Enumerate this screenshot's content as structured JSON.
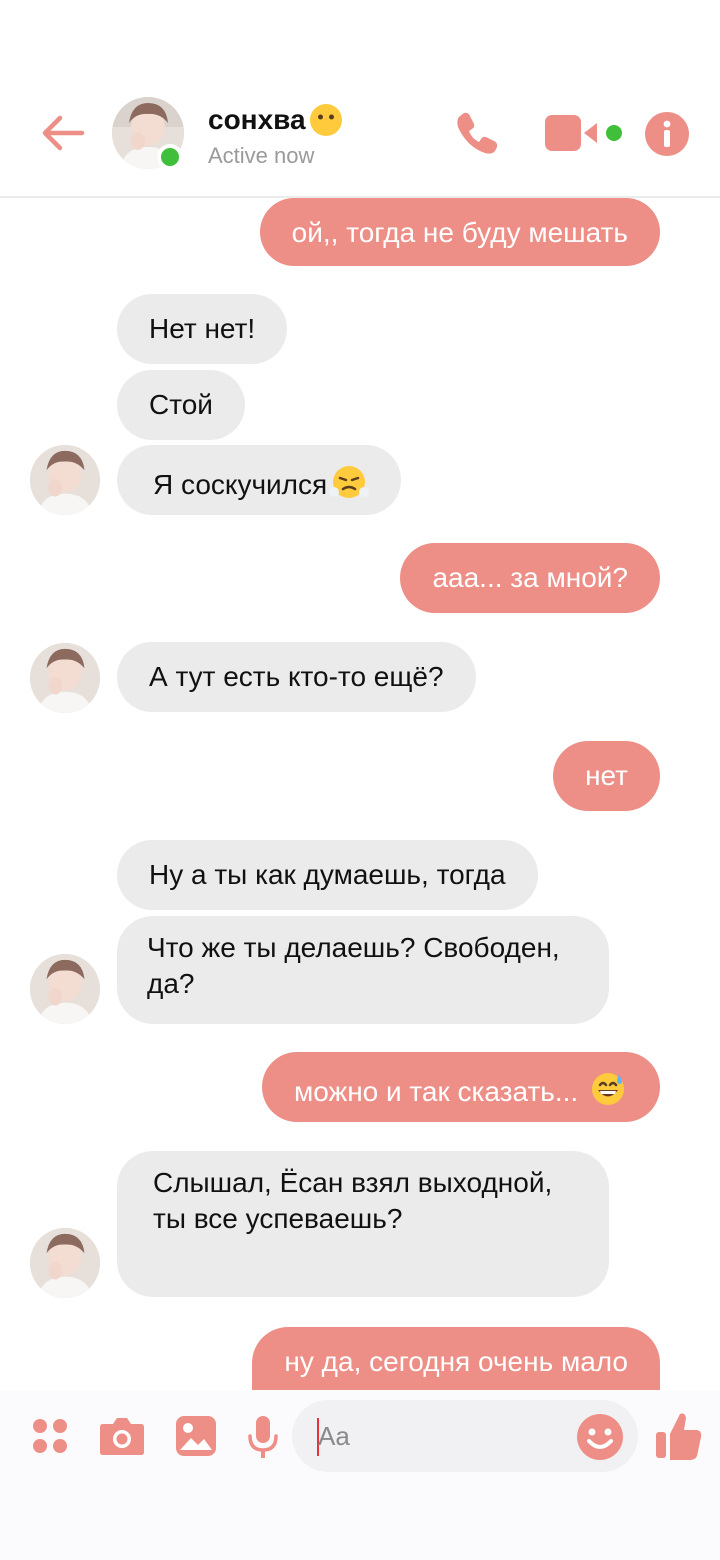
{
  "header": {
    "contact_name": "сонхва",
    "status": "Active now",
    "icons": {
      "back": "back-arrow-icon",
      "call": "phone-icon",
      "video": "video-camera-icon",
      "info": "info-icon"
    }
  },
  "messages": [
    {
      "from": "me",
      "text": "ой,, тогда не буду мешать"
    },
    {
      "from": "contact",
      "text": "Нет нет!"
    },
    {
      "from": "contact",
      "text": "Стой"
    },
    {
      "from": "contact",
      "text": "Я соскучился"
    },
    {
      "from": "me",
      "text": "ааа... за мной?"
    },
    {
      "from": "contact",
      "text": "А тут есть кто-то ещё?"
    },
    {
      "from": "me",
      "text": "нет"
    },
    {
      "from": "contact",
      "text": "Ну а ты как думаешь, тогда"
    },
    {
      "from": "contact",
      "text": "Что же ты делаешь? Свободен, да?"
    },
    {
      "from": "me",
      "text": "можно и так сказать..."
    },
    {
      "from": "contact",
      "text": "Слышал, Ёсан взял выходной, ты все успеваешь?"
    },
    {
      "from": "me",
      "text": "ну да, сегодня очень мало"
    }
  ],
  "composer": {
    "placeholder": "Aa",
    "icons": [
      "menu-grid-icon",
      "camera-icon",
      "image-icon",
      "microphone-icon",
      "emoji-smile-icon",
      "thumbs-up-icon"
    ]
  },
  "colors": {
    "accent": "#ed8e87",
    "incoming_bubble": "#ebebeb",
    "online": "#3fbf3a"
  }
}
